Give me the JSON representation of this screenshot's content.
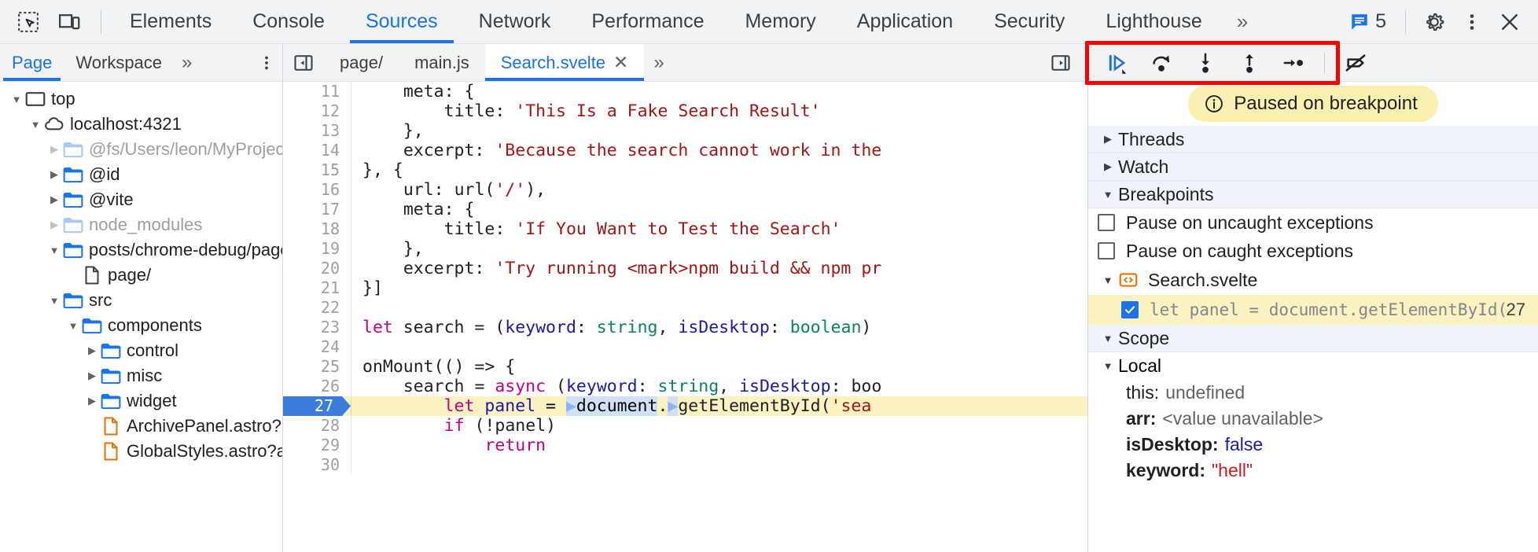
{
  "toolbar": {
    "icons": [
      {
        "name": "inspect-element-icon",
        "label": "Inspect element"
      },
      {
        "name": "device-toolbar-icon",
        "label": "Toggle device toolbar"
      }
    ],
    "tabs": [
      {
        "label": "Elements",
        "active": false
      },
      {
        "label": "Console",
        "active": false
      },
      {
        "label": "Sources",
        "active": true
      },
      {
        "label": "Network",
        "active": false
      },
      {
        "label": "Performance",
        "active": false
      },
      {
        "label": "Memory",
        "active": false
      },
      {
        "label": "Application",
        "active": false
      },
      {
        "label": "Security",
        "active": false
      },
      {
        "label": "Lighthouse",
        "active": false
      }
    ],
    "more_tabs": "»",
    "issues_count": "5",
    "issues_icon": "issues-icon",
    "settings_icon": "gear-icon",
    "menu_icon": "three-dot-menu-icon",
    "close_icon": "close-icon"
  },
  "navigator": {
    "tabs": [
      {
        "label": "Page",
        "active": true
      },
      {
        "label": "Workspace",
        "active": false
      }
    ],
    "more_tabs": "»",
    "kebab_icon": "more-options-icon",
    "tree": [
      {
        "label": "top",
        "indent": 0,
        "twisty": "down",
        "icon": "frame-icon",
        "dim": false
      },
      {
        "label": "localhost:4321",
        "indent": 1,
        "twisty": "down",
        "icon": "cloud-icon",
        "dim": false
      },
      {
        "label": "@fs/Users/leon/MyProject/bl",
        "indent": 2,
        "twisty": "right",
        "icon": "folder-icon",
        "dim": true
      },
      {
        "label": "@id",
        "indent": 2,
        "twisty": "right",
        "icon": "folder-icon",
        "dim": false
      },
      {
        "label": "@vite",
        "indent": 2,
        "twisty": "right",
        "icon": "folder-icon",
        "dim": false
      },
      {
        "label": "node_modules",
        "indent": 2,
        "twisty": "right",
        "icon": "folder-icon",
        "dim": true
      },
      {
        "label": "posts/chrome-debug/page",
        "indent": 2,
        "twisty": "down",
        "icon": "folder-icon",
        "dim": false
      },
      {
        "label": "page/",
        "indent": 3,
        "twisty": "none",
        "icon": "document-icon",
        "dim": false
      },
      {
        "label": "src",
        "indent": 2,
        "twisty": "down",
        "icon": "folder-icon",
        "dim": false
      },
      {
        "label": "components",
        "indent": 3,
        "twisty": "down",
        "icon": "folder-icon",
        "dim": false
      },
      {
        "label": "control",
        "indent": 4,
        "twisty": "right",
        "icon": "folder-icon",
        "dim": false
      },
      {
        "label": "misc",
        "indent": 4,
        "twisty": "right",
        "icon": "folder-icon",
        "dim": false
      },
      {
        "label": "widget",
        "indent": 4,
        "twisty": "right",
        "icon": "folder-icon",
        "dim": false
      },
      {
        "label": "ArchivePanel.astro?astro",
        "indent": 4,
        "twisty": "none",
        "icon": "astro-file-icon",
        "dim": false
      },
      {
        "label": "GlobalStyles.astro?astro",
        "indent": 4,
        "twisty": "none",
        "icon": "astro-file-icon",
        "dim": false
      }
    ]
  },
  "editor": {
    "panel_toggle_icon": "show-navigator-icon",
    "tabs": [
      {
        "label": "page/",
        "active": false,
        "closable": false
      },
      {
        "label": "main.js",
        "active": false,
        "closable": false
      },
      {
        "label": "Search.svelte",
        "active": true,
        "closable": true
      }
    ],
    "more_tabs": "»",
    "close_glyph": "✕",
    "split_icon": "show-debugger-icon",
    "lines": [
      {
        "num": "11",
        "text": "    meta: {",
        "hl": false,
        "bp": false
      },
      {
        "num": "12",
        "text": "        title: 'This Is a Fake Search Result'",
        "hl": false,
        "bp": false
      },
      {
        "num": "13",
        "text": "    },",
        "hl": false,
        "bp": false
      },
      {
        "num": "14",
        "text": "    excerpt: 'Because the search cannot work in the",
        "hl": false,
        "bp": false
      },
      {
        "num": "15",
        "text": "}, {",
        "hl": false,
        "bp": false
      },
      {
        "num": "16",
        "text": "    url: url('/'),",
        "hl": false,
        "bp": false
      },
      {
        "num": "17",
        "text": "    meta: {",
        "hl": false,
        "bp": false
      },
      {
        "num": "18",
        "text": "        title: 'If You Want to Test the Search'",
        "hl": false,
        "bp": false
      },
      {
        "num": "19",
        "text": "    },",
        "hl": false,
        "bp": false
      },
      {
        "num": "20",
        "text": "    excerpt: 'Try running <mark>npm build && npm pr",
        "hl": false,
        "bp": false
      },
      {
        "num": "21",
        "text": "}]",
        "hl": false,
        "bp": false
      },
      {
        "num": "22",
        "text": "",
        "hl": false,
        "bp": false
      },
      {
        "num": "23",
        "text": "let search = (keyword: string, isDesktop: boolean)",
        "hl": false,
        "bp": false
      },
      {
        "num": "24",
        "text": "",
        "hl": false,
        "bp": false
      },
      {
        "num": "25",
        "text": "onMount(() => {",
        "hl": false,
        "bp": false
      },
      {
        "num": "26",
        "text": "    search = async (keyword: string, isDesktop: boo",
        "hl": false,
        "bp": false
      },
      {
        "num": "27",
        "text": "        let panel = document.getElementById('sea",
        "hl": true,
        "bp": true
      },
      {
        "num": "28",
        "text": "        if (!panel)",
        "hl": false,
        "bp": false
      },
      {
        "num": "29",
        "text": "            return",
        "hl": false,
        "bp": false
      },
      {
        "num": "30",
        "text": "",
        "hl": false,
        "bp": false
      }
    ]
  },
  "debugger": {
    "buttons": [
      {
        "name": "resume-script-execution-button",
        "label": "Resume script execution"
      },
      {
        "name": "step-over-button",
        "label": "Step over next function call"
      },
      {
        "name": "step-into-button",
        "label": "Step into next function call"
      },
      {
        "name": "step-out-button",
        "label": "Step out of current function"
      },
      {
        "name": "step-button",
        "label": "Step"
      },
      {
        "name": "deactivate-breakpoints-button",
        "label": "Deactivate breakpoints"
      }
    ],
    "paused_notice": "Paused on breakpoint",
    "paused_icon": "info-icon",
    "sections": [
      {
        "label": "Threads",
        "expanded": false
      },
      {
        "label": "Watch",
        "expanded": false
      },
      {
        "label": "Breakpoints",
        "expanded": true
      }
    ],
    "breakpoint_options": [
      {
        "label": "Pause on uncaught exceptions",
        "checked": false
      },
      {
        "label": "Pause on caught exceptions",
        "checked": false
      }
    ],
    "breakpoint_file": "Search.svelte",
    "breakpoint_file_icon": "svelte-file-icon",
    "breakpoint_item": {
      "code": "let panel = document.getElementById('searc…",
      "line": "27",
      "checked": true
    },
    "scope_label": "Scope",
    "local_label": "Local",
    "scope_vars": [
      {
        "name": "this:",
        "value": "undefined",
        "bold": false,
        "vtype": "dim"
      },
      {
        "name": "arr:",
        "value": "<value unavailable>",
        "bold": true,
        "vtype": "unavail"
      },
      {
        "name": "isDesktop:",
        "value": "false",
        "bold": true,
        "vtype": "num"
      },
      {
        "name": "keyword:",
        "value": "\"hell\"",
        "bold": true,
        "vtype": "str"
      }
    ]
  },
  "colors": {
    "accent": "#1a73e8",
    "highlight_yellow": "#fbf2c2",
    "toolbar_bg": "#f1f3f4",
    "red_box": "#ff0000",
    "breakpoint_blue": "#3b7ddd"
  }
}
